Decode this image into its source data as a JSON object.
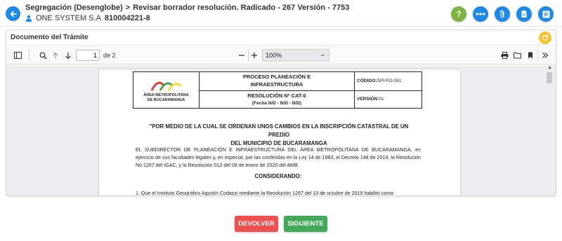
{
  "header": {
    "title_part1": "Segregación (Desenglobe)",
    "title_sep": ">",
    "title_part2": "Revisar borrador resolución. Radicado - 267 Versión - 7753",
    "company_name": "ONE SYSTEM S.A",
    "company_id": "810004221-8",
    "action_icons": [
      "help-icon",
      "dots-icon",
      "attachment-icon",
      "document-icon",
      "list-icon"
    ]
  },
  "card": {
    "title": "Documento del Trámite"
  },
  "pdf_toolbar": {
    "page_current": "1",
    "page_total": "de 2",
    "zoom": "100%"
  },
  "document": {
    "logo_text_1": "ÁREA METROPOLITANA",
    "logo_text_2": "DE BUCARAMANGA",
    "process_1": "PROCESO PLANEACIÓN E",
    "process_2": "INFRAESTRUCTURA",
    "code_label": "CÓDIGO:",
    "code_value": "SPI-FO-051",
    "resolution": "RESOLUCIÓN Nº CAT-0",
    "resolution_date": "(Fecha N/D - N/D - N/D)",
    "version_label": "VERSIÓN:",
    "version_value": "01",
    "heading_1": "\"POR MEDIO DE LA CUAL SE ORDENAN UNOS CAMBIOS EN LA INSCRIPCIÓN CATASTRAL DE UN PREDIO",
    "heading_2": "DEL MUNICIPIO DE BUCARAMANGA",
    "paragraph": "EL SUBDIRECTOR DE PLANEACIÓN E INFRAESTRUCTURA DEL ÁREA METROPOLITANA DE BUCARAMANGA, en ejercicio de sus facultades legales y, en especial, por las conferidas en la Ley 14 de 1983, el Decreto 148 de 2019, la Resolución No 1267 del IGAC, y la Resolución 012 del 09 de enero de 2020 del AMB.",
    "considerando": "CONSIDERANDO:",
    "item_1": "1. Que el Instituto Geográfico Agustín Codazzi mediante la Resolución 1267 del 10 de octubre de 2019 habilitó como"
  },
  "buttons": {
    "return": "DEVOLVER",
    "next": "SIGUIENTE"
  },
  "colors": {
    "primary_blue": "#1e88e5",
    "help_green": "#7cb342",
    "refresh_yellow": "#fbc02d",
    "return_red": "#ef4f4f",
    "next_green": "#43a85a"
  }
}
